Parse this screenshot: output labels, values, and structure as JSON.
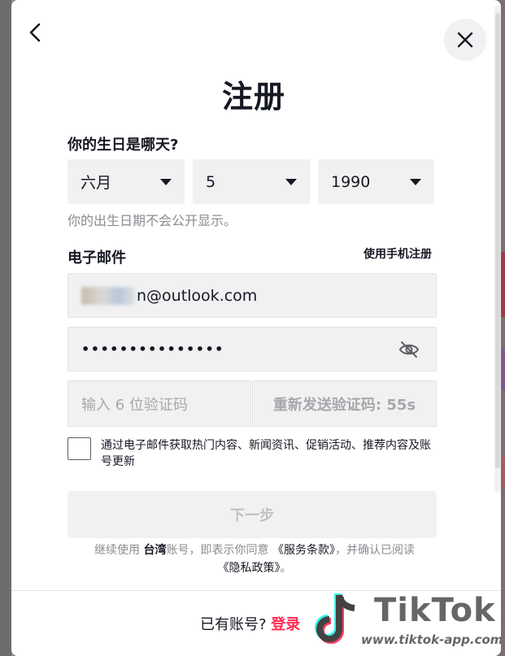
{
  "title": "注册",
  "birthday": {
    "label": "你的生日是哪天?",
    "month": "六月",
    "day": "5",
    "year": "1990",
    "hint": "你的出生日期不会公开显示。"
  },
  "email": {
    "label": "电子邮件",
    "phone_link": "使用手机注册",
    "value_suffix": "n@outlook.com",
    "password_masked": "•••••••••••••••"
  },
  "code": {
    "placeholder": "输入 6 位验证码",
    "resend_label": "重新发送验证码: 55s"
  },
  "marketing": {
    "text": "通过电子邮件获取热门内容、新闻资讯、促销活动、推荐内容及账号更新"
  },
  "next_button": "下一步",
  "terms": {
    "prefix": "继续使用 ",
    "region": "台湾",
    "middle": "账号，即表示你同意 ",
    "service_terms": "《服务条款》",
    "middle2": "，并确认已阅读 ",
    "privacy_policy": "《隐私政策》",
    "suffix": "。"
  },
  "footer": {
    "question": "已有账号?",
    "login": "登录"
  },
  "watermark": {
    "brand": "TikTok",
    "url": "www.tiktok-app.com"
  },
  "icons": {
    "back": "chevron-left-icon",
    "close": "close-icon",
    "caret": "caret-down-icon",
    "eye": "eye-slash-icon"
  },
  "colors": {
    "accent": "#fe2c55",
    "field_bg": "#f1f1f2"
  }
}
